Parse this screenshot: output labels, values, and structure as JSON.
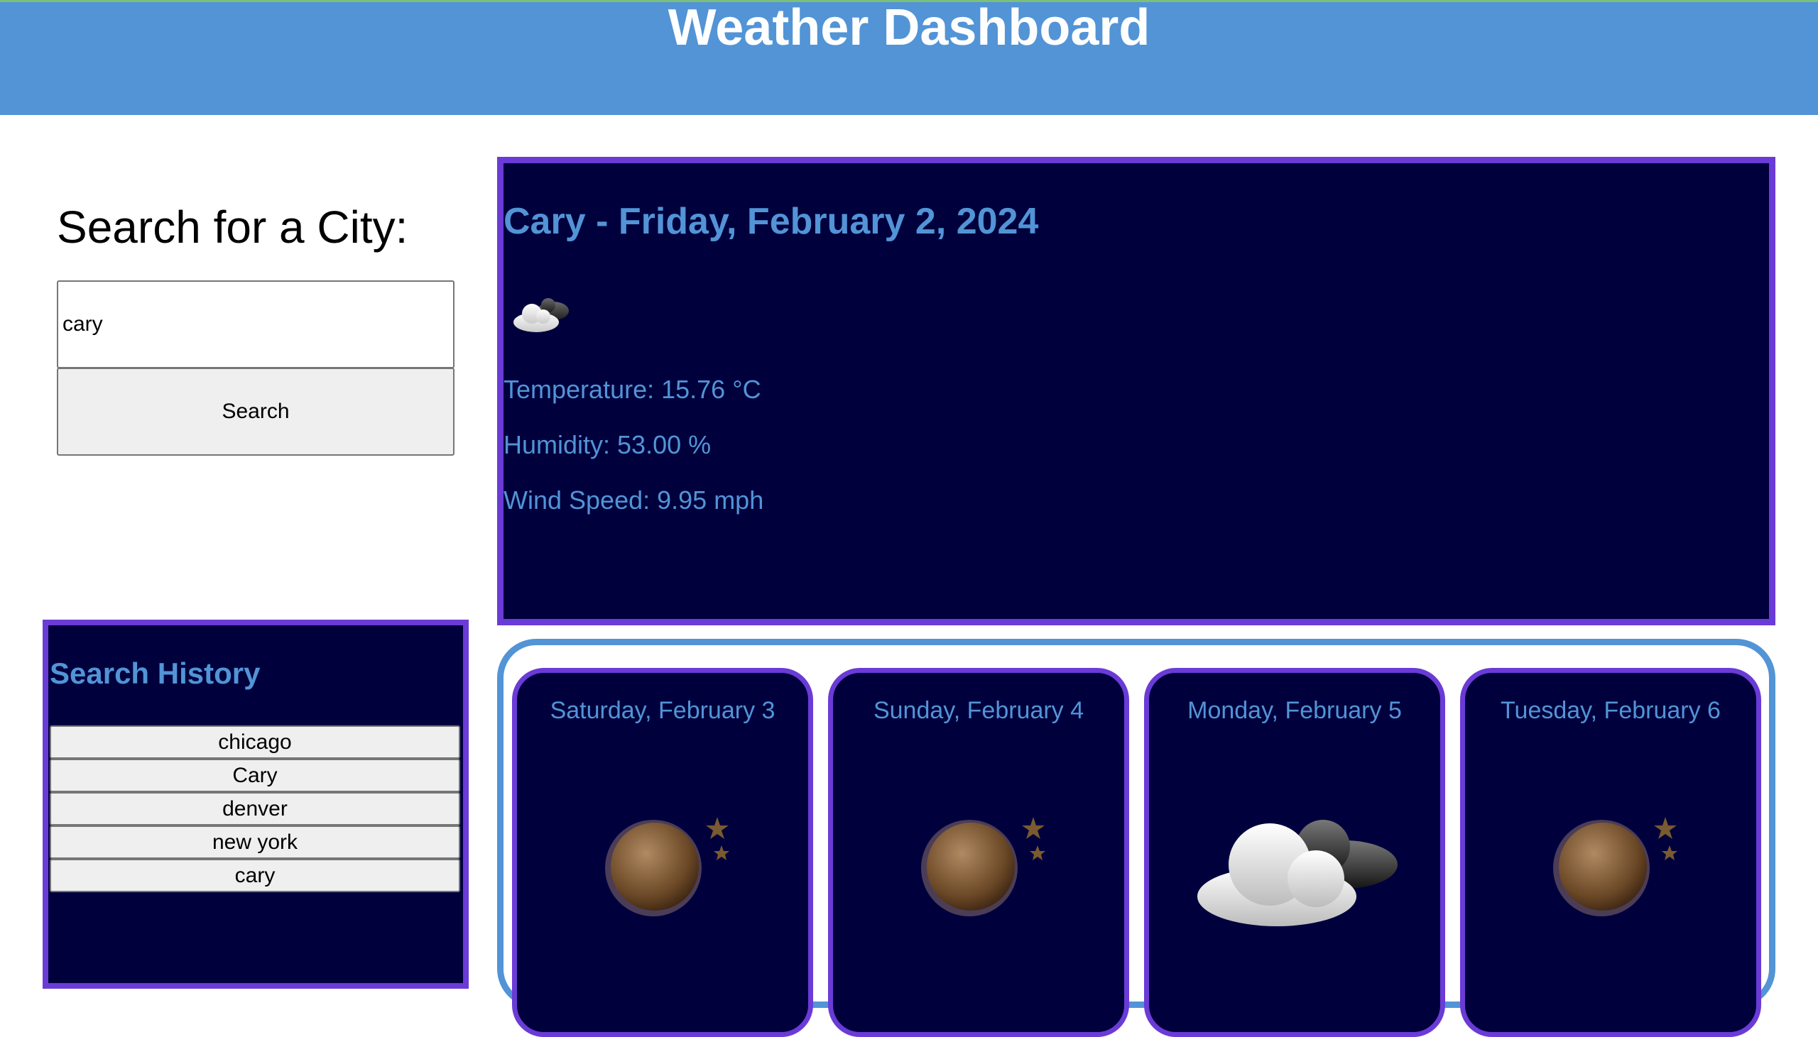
{
  "header": {
    "title": "Weather Dashboard"
  },
  "search": {
    "title": "Search for a City:",
    "input_value": "cary",
    "button_label": "Search"
  },
  "history": {
    "title": "Search History",
    "items": [
      "chicago",
      "Cary",
      "denver",
      "new york",
      "cary"
    ]
  },
  "current": {
    "heading": "Cary - Friday, February 2, 2024",
    "icon": "partly-cloudy-night-icon",
    "temperature": "Temperature: 15.76 °C",
    "humidity": "Humidity: 53.00 %",
    "wind": "Wind Speed: 9.95 mph"
  },
  "forecast": [
    {
      "date": "Saturday, February 3",
      "icon": "clear-night-icon"
    },
    {
      "date": "Sunday, February 4",
      "icon": "clear-night-icon"
    },
    {
      "date": "Monday, February 5",
      "icon": "partly-cloudy-night-icon"
    },
    {
      "date": "Tuesday, February 6",
      "icon": "clear-night-icon"
    }
  ],
  "colors": {
    "header_bg": "#5294d6",
    "panel_bg": "#00003d",
    "panel_border": "#6a3bd6",
    "accent_text": "#5294d6"
  }
}
